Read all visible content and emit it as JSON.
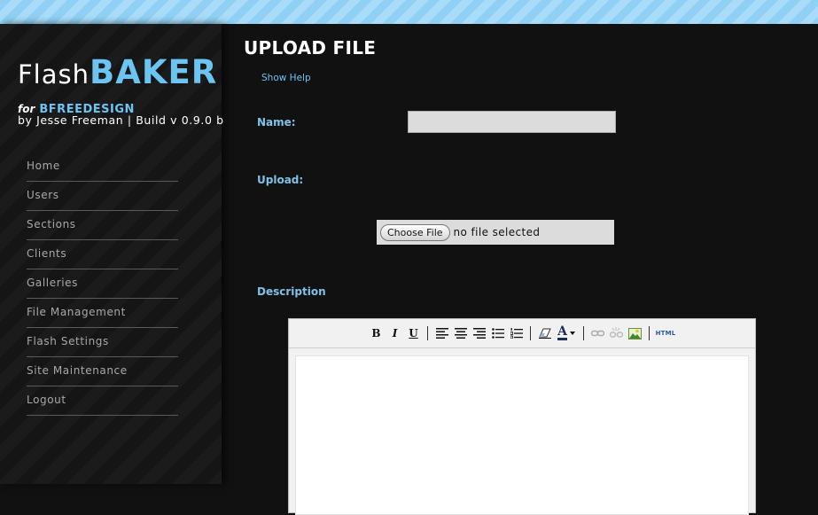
{
  "logo": {
    "flash": "Flash",
    "baker": "BAKER"
  },
  "tagline": {
    "for": "for",
    "brand": "BFREEDESIGN"
  },
  "byline": "by Jesse Freeman | Build v 0.9.0 b",
  "nav": {
    "items": [
      {
        "label": "Home"
      },
      {
        "label": "Users"
      },
      {
        "label": "Sections"
      },
      {
        "label": "Clients"
      },
      {
        "label": "Galleries"
      },
      {
        "label": "File Management"
      },
      {
        "label": "Flash Settings"
      },
      {
        "label": "Site Maintenance"
      },
      {
        "label": "Logout"
      }
    ]
  },
  "page": {
    "title": "UPLOAD FILE",
    "show_help": "Show Help"
  },
  "form": {
    "name_label": "Name:",
    "name_value": "",
    "upload_label": "Upload:",
    "choose_file": "Choose File",
    "file_status": "no file selected",
    "description_label": "Description"
  },
  "editor": {
    "toolbar": [
      "bold-icon",
      "italic-icon",
      "underline-icon",
      "align-left-icon",
      "align-center-icon",
      "align-right-icon",
      "unordered-list-icon",
      "ordered-list-icon",
      "eraser-icon",
      "text-color-icon",
      "link-icon",
      "unlink-icon",
      "insert-image-icon",
      "html-source-icon"
    ],
    "bold": "B",
    "italic": "I",
    "underline": "U",
    "html": "HTML",
    "text_color": "A"
  },
  "colors": {
    "accent": "#6cc4f2",
    "label": "#7fc2e8",
    "background": "#111111"
  }
}
